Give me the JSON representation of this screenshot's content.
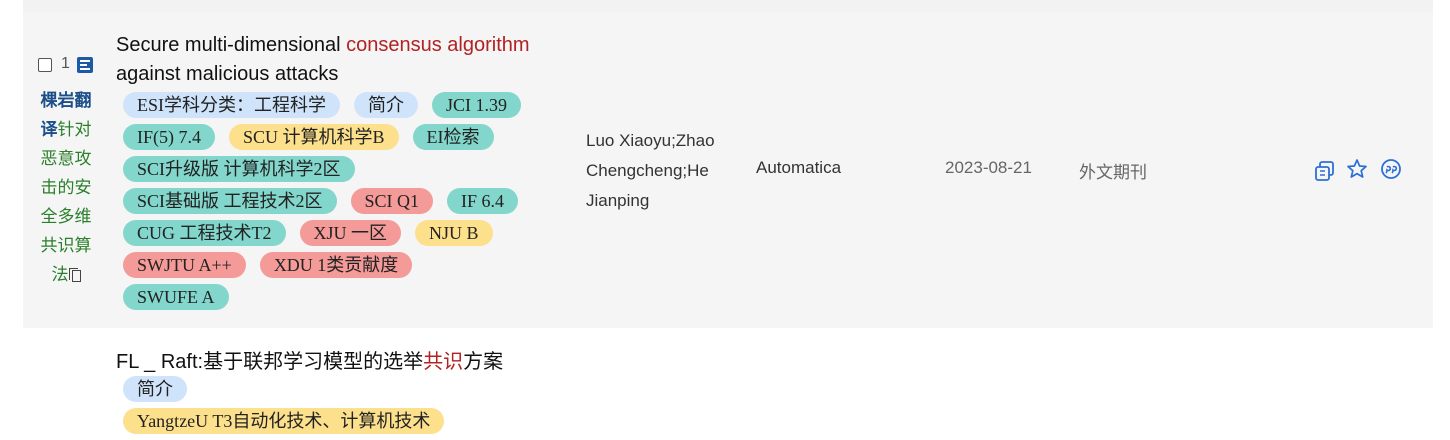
{
  "row1": {
    "index": "1",
    "translate_label": "棵岩翻译",
    "translated_title": "针对恶意攻击的安全多维共识算法",
    "title_pre": "Secure multi-dimensional ",
    "title_hl": "consensus algorithm",
    "title_post": " against malicious attacks",
    "tags": [
      [
        "ESI学科分类：工程科学",
        "简介",
        "JCI 1.39"
      ],
      [
        "IF(5) 7.4",
        "SCU 计算机科学B",
        "EI检索"
      ],
      [
        "SCI升级版 计算机科学2区"
      ],
      [
        "SCI基础版 工程技术2区",
        "SCI Q1",
        "IF 6.4"
      ],
      [
        "CUG 工程技术T2",
        "XJU 一区",
        "NJU B"
      ],
      [
        "SWJTU A++",
        "XDU 1类贡献度"
      ],
      [
        "SWUFE A"
      ]
    ],
    "tag_colors": [
      [
        "blue",
        "blue",
        "teal"
      ],
      [
        "teal",
        "yellow",
        "teal"
      ],
      [
        "teal"
      ],
      [
        "teal",
        "red",
        "teal"
      ],
      [
        "teal",
        "red",
        "yellow"
      ],
      [
        "red",
        "red"
      ],
      [
        "teal"
      ]
    ],
    "authors": "Luo Xiaoyu;Zhao Chengcheng;He Jianping",
    "journal": "Automatica",
    "date": "2023-08-21",
    "type": "外文期刊"
  },
  "row2": {
    "title_pre": "FL _ Raft:基于联邦学习模型的选举",
    "title_hl": "共识",
    "title_post": "方案",
    "tags": [
      [
        "简介"
      ],
      [
        "YangtzeU T3自动化技术、计算机技术"
      ]
    ],
    "tag_colors": [
      [
        "blue"
      ],
      [
        "yellow"
      ]
    ]
  },
  "icons": [
    "copy-icon",
    "star-icon",
    "quote-icon"
  ],
  "colors": {
    "highlight": "#b22222",
    "blue_tag": "#cfe3fb",
    "teal_tag": "#82d6cb",
    "yellow_tag": "#fde08c",
    "red_tag": "#f49a98",
    "icon_blue": "#1c5aa8"
  }
}
